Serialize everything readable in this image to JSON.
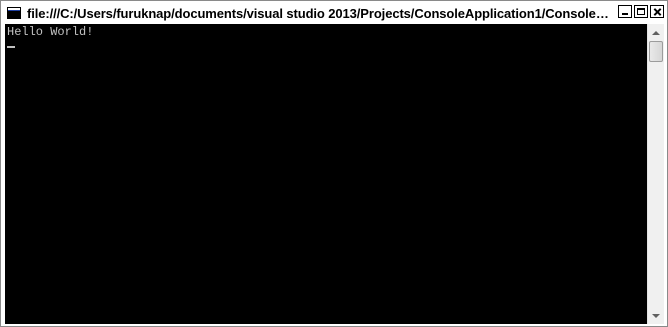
{
  "window": {
    "title": "file:///C:/Users/furuknap/documents/visual studio 2013/Projects/ConsoleApplication1/ConsoleApplic...",
    "icon": "console-icon",
    "controls": [
      "minimize-icon",
      "maximize-icon",
      "close-icon"
    ]
  },
  "console": {
    "lines": [
      "Hello World!"
    ],
    "cursor": "_",
    "background": "#000000",
    "foreground": "#c0c0c0"
  },
  "scrollbar": {
    "icons": [
      "scroll-up-arrow-icon",
      "scroll-down-arrow-icon"
    ],
    "position": 0
  }
}
